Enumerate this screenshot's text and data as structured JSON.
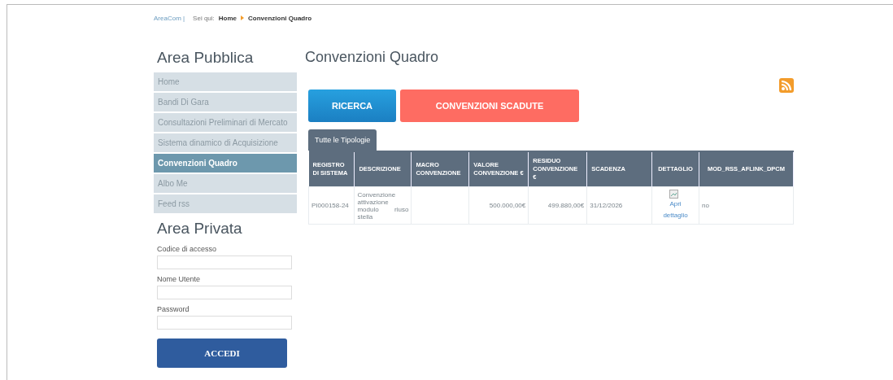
{
  "breadcrumb": {
    "site": "AreaCom |",
    "prefix": "Sei qui:",
    "items": [
      "Home",
      "Convenzioni Quadro"
    ]
  },
  "sidebar": {
    "public_title": "Area Pubblica",
    "items": [
      {
        "label": "Home",
        "selected": false
      },
      {
        "label": "Bandi Di Gara",
        "selected": false
      },
      {
        "label": "Consultazioni Preliminari di Mercato",
        "selected": false
      },
      {
        "label": "Sistema dinamico di Acquisizione",
        "selected": false
      },
      {
        "label": "Convenzioni Quadro",
        "selected": true
      },
      {
        "label": "Albo Me",
        "selected": false
      },
      {
        "label": "Feed rss",
        "selected": false
      }
    ],
    "private_title": "Area Privata",
    "fields": [
      {
        "label": "Codice di accesso"
      },
      {
        "label": "Nome Utente"
      },
      {
        "label": "Password"
      }
    ],
    "login_button": "ACCEDI"
  },
  "main": {
    "title": "Convenzioni Quadro",
    "buttons": [
      {
        "label": "RICERCA",
        "kind": "primary"
      },
      {
        "label": "CONVENZIONI SCADUTE",
        "kind": "danger"
      }
    ],
    "tabs": [
      {
        "label": "Tutte le Tipologie",
        "selected": true
      }
    ],
    "table": {
      "columns": [
        "REGISTRO DI SISTEMA",
        "DESCRIZIONE",
        "MACRO CONVENZIONE",
        "VALORE CONVENZIONE €",
        "RESIDUO CONVENZIONE €",
        "SCADENZA",
        "DETTAGLIO",
        "MOD_RSS_AFLINK_DPCM"
      ],
      "rows": [
        {
          "registro": "PI000158-24",
          "descrizione": "Convenzione attivazione modulo riuso stella",
          "macro": "",
          "valore": "500.000,00€",
          "residuo": "499.880,00€",
          "scadenza": "31/12/2026",
          "dettaglio": "Apri dettaglio",
          "mod": "no"
        }
      ]
    }
  }
}
